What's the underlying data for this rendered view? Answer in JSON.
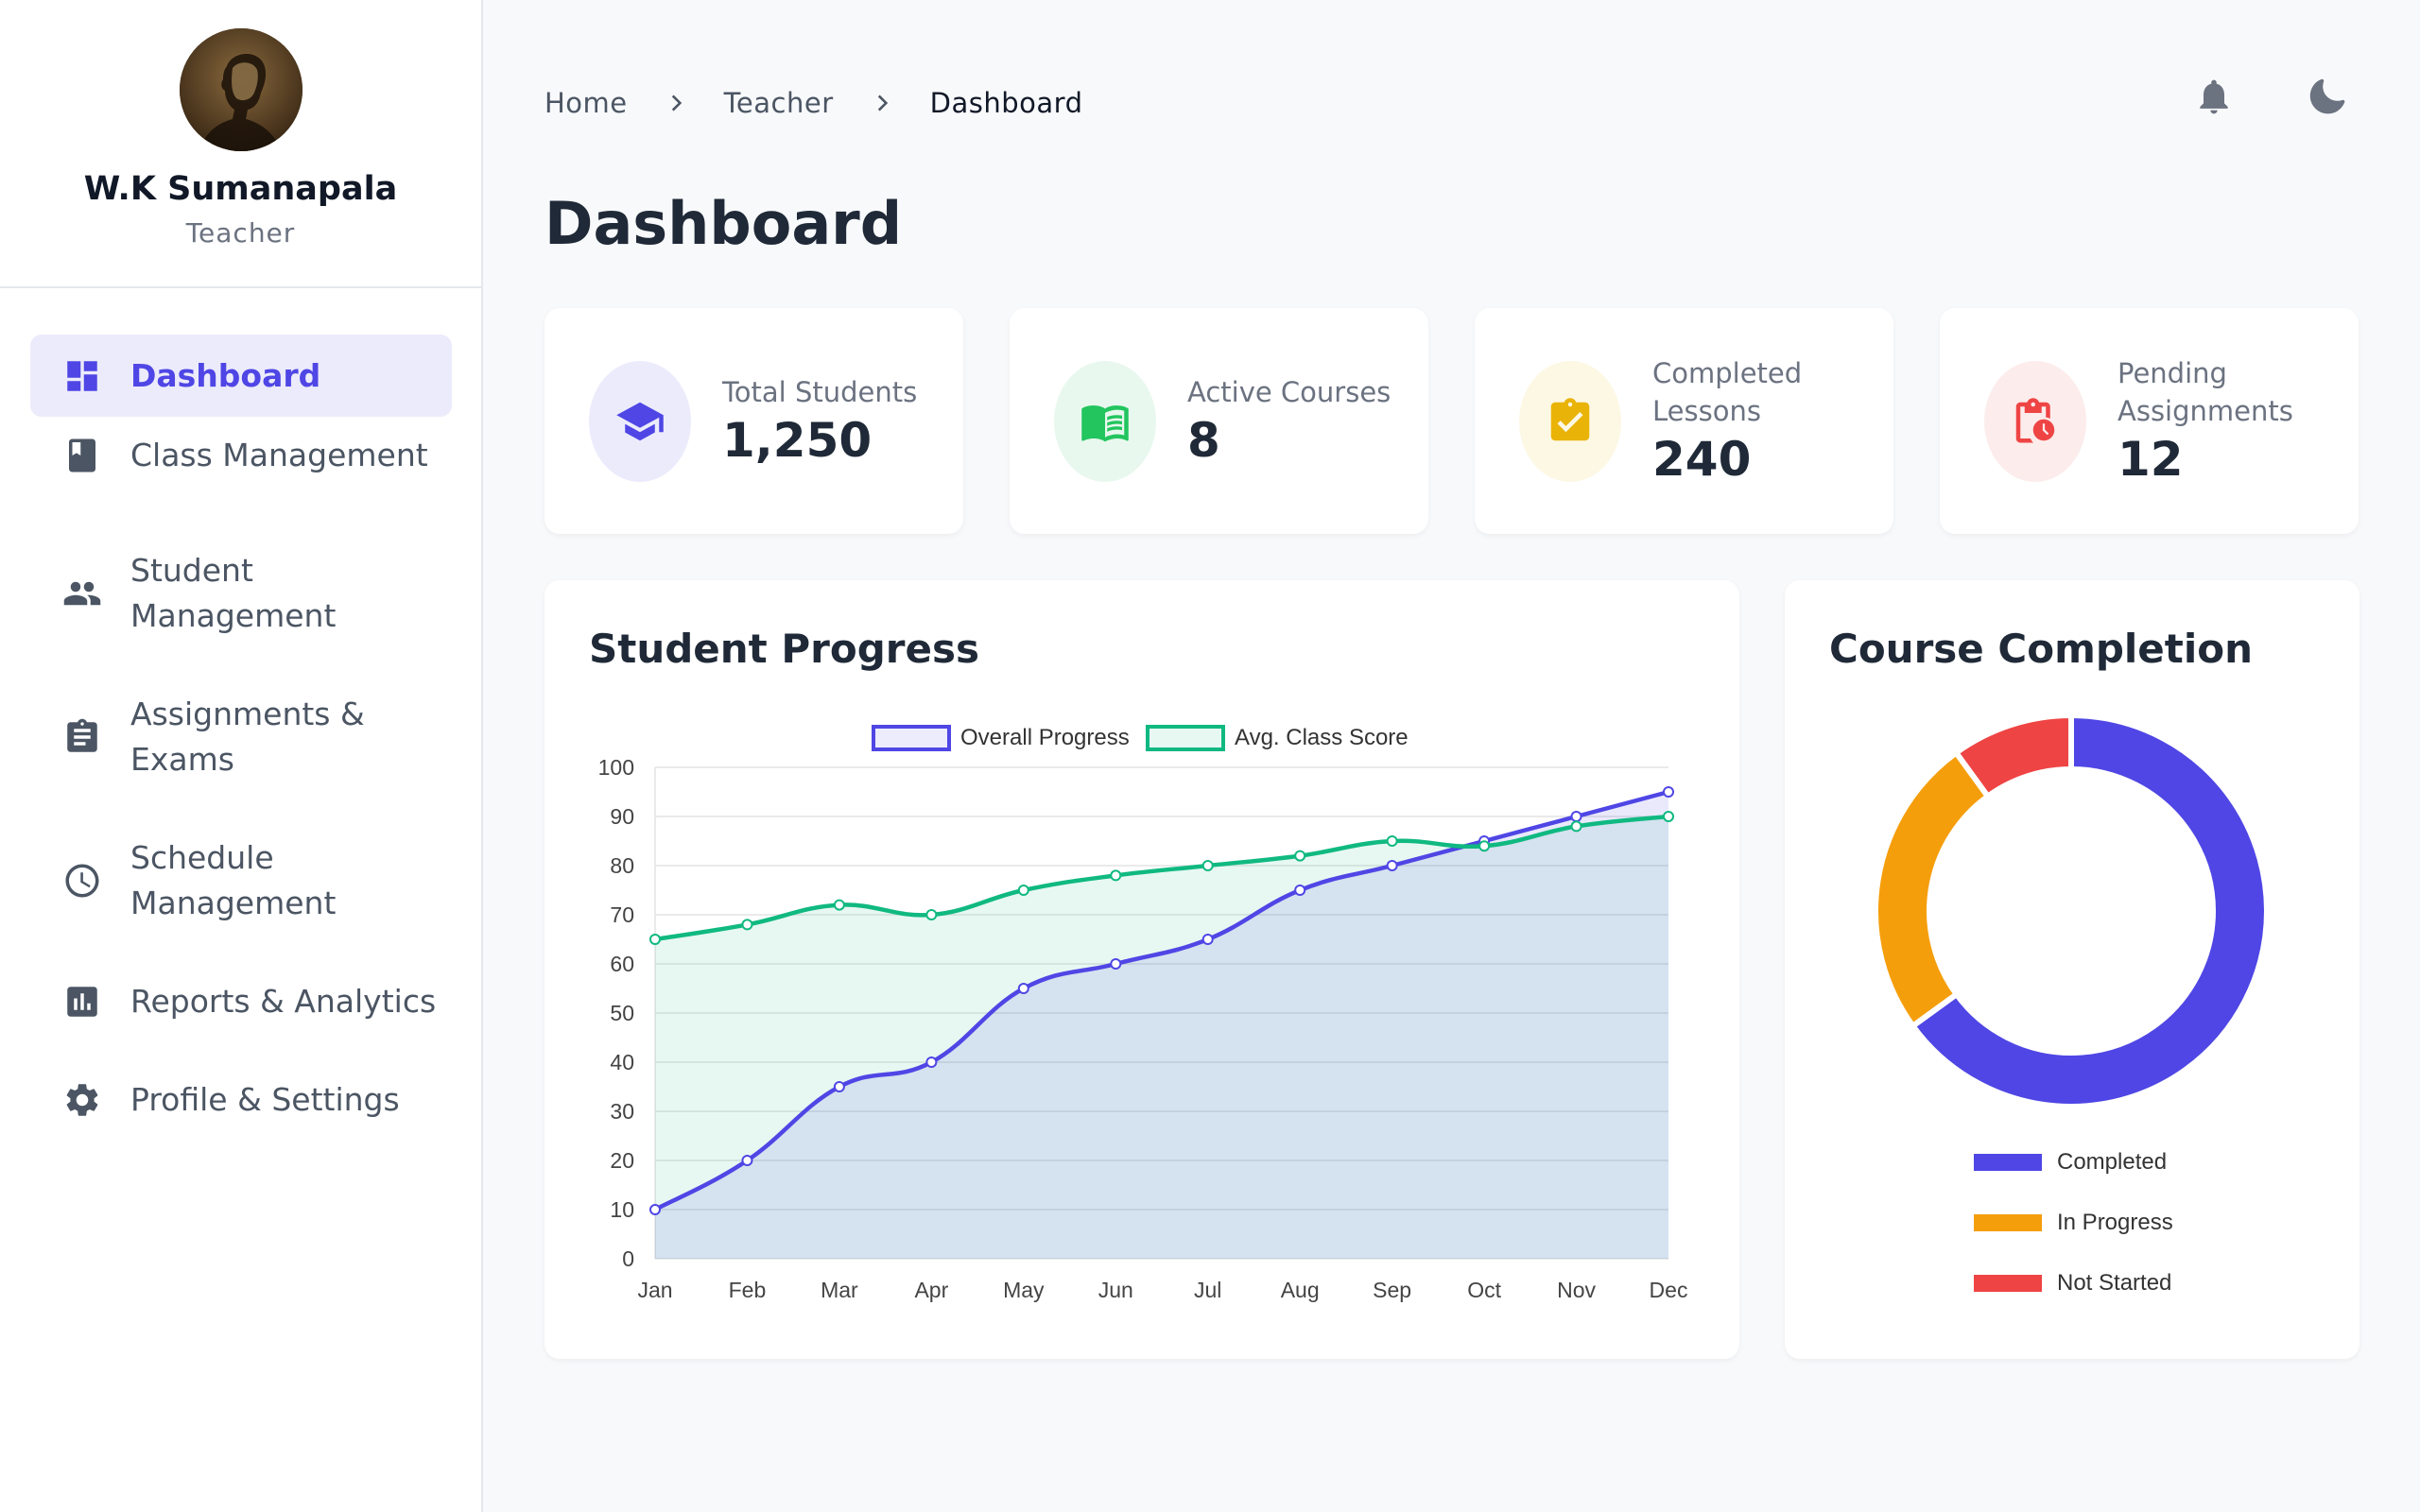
{
  "profile": {
    "name": "W.K Sumanapala",
    "role": "Teacher"
  },
  "nav": [
    {
      "label": "Dashboard",
      "icon": "dashboard-icon",
      "active": true
    },
    {
      "label": "Class Management",
      "icon": "book-icon",
      "active": false
    },
    {
      "label": "Student\nManagement",
      "icon": "people-icon",
      "active": false
    },
    {
      "label": "Assignments &\nExams",
      "icon": "clipboard-icon",
      "active": false
    },
    {
      "label": "Schedule\nManagement",
      "icon": "clock-icon",
      "active": false
    },
    {
      "label": "Reports & Analytics",
      "icon": "bar-chart-icon",
      "active": false
    },
    {
      "label": "Profile & Settings",
      "icon": "gear-icon",
      "active": false
    }
  ],
  "breadcrumb": [
    "Home",
    "Teacher",
    "Dashboard"
  ],
  "page_title": "Dashboard",
  "stats": [
    {
      "label": "Total Students",
      "value": "1,250",
      "icon": "graduation-cap-icon",
      "color": "#4f46e5",
      "bg": "#ecebfb"
    },
    {
      "label": "Active Courses",
      "value": "8",
      "icon": "open-book-icon",
      "color": "#22c55e",
      "bg": "#e8f8ee"
    },
    {
      "label": "Completed Lessons",
      "value": "240",
      "icon": "clipboard-check-icon",
      "color": "#eab308",
      "bg": "#fdf8e4"
    },
    {
      "label": "Pending Assignments",
      "value": "12",
      "icon": "clipboard-clock-icon",
      "color": "#ef4444",
      "bg": "#fdecec"
    }
  ],
  "progress_title": "Student Progress",
  "completion_title": "Course Completion",
  "chart_data": [
    {
      "type": "line",
      "title": "Student Progress",
      "categories": [
        "Jan",
        "Feb",
        "Mar",
        "Apr",
        "May",
        "Jun",
        "Jul",
        "Aug",
        "Sep",
        "Oct",
        "Nov",
        "Dec"
      ],
      "series": [
        {
          "name": "Overall Progress",
          "values": [
            10,
            20,
            35,
            40,
            55,
            60,
            65,
            75,
            80,
            85,
            90,
            95
          ],
          "color": "#4f46e5"
        },
        {
          "name": "Avg. Class Score",
          "values": [
            65,
            68,
            72,
            70,
            75,
            78,
            80,
            82,
            85,
            84,
            88,
            90
          ],
          "color": "#10b981"
        }
      ],
      "ylim": [
        0,
        100
      ],
      "yticks": [
        0,
        10,
        20,
        30,
        40,
        50,
        60,
        70,
        80,
        90,
        100
      ],
      "legend": "top",
      "grid": true,
      "filled": true
    },
    {
      "type": "pie",
      "title": "Course Completion",
      "labels": [
        "Completed",
        "In Progress",
        "Not Started"
      ],
      "values": [
        65,
        25,
        10
      ],
      "colors": [
        "#4f46e5",
        "#f59e0b",
        "#ef4444"
      ],
      "legend": "bottom"
    }
  ]
}
